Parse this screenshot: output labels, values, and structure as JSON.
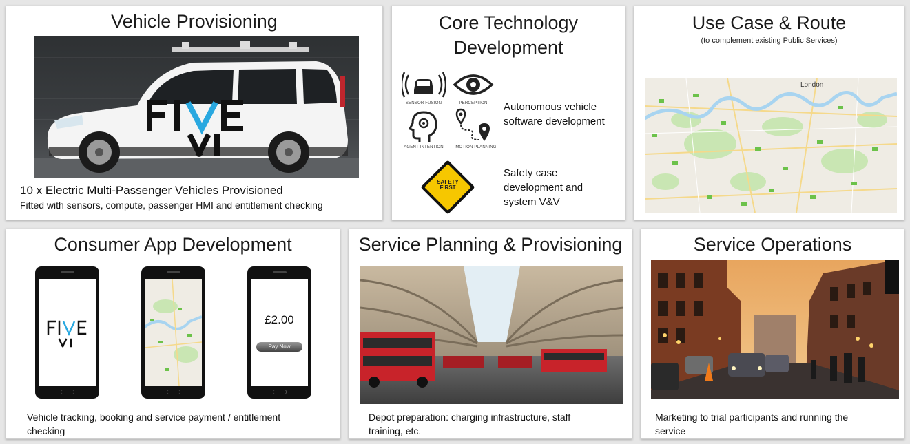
{
  "panels": {
    "vehicle": {
      "title": "Vehicle Provisioning",
      "brand": "FIVE AI",
      "caption_main": "10 x Electric Multi-Passenger Vehicles Provisioned",
      "caption_sub": "Fitted with sensors, compute, passenger HMI and entitlement checking"
    },
    "core_tech": {
      "title_line1": "Core Technology",
      "title_line2": "Development",
      "icon_labels": {
        "sensor_fusion": "Sensor Fusion",
        "perception": "Perception",
        "agent_intention": "Agent Intention",
        "motion_planning": "Motion Planning"
      },
      "safety_sign_line1": "SAFETY",
      "safety_sign_line2": "FIRST",
      "text1_line1": "Autonomous vehicle",
      "text1_line2": "software development",
      "text2_line1": "Safety case",
      "text2_line2": "development and",
      "text2_line3": "system V&V"
    },
    "use_case": {
      "title": "Use Case & Route",
      "subtitle": "(to complement existing Public Services)",
      "map_label": "London"
    },
    "consumer_app": {
      "title": "Consumer App Development",
      "phone1_brand": "FIVE AI",
      "phone3_price": "£2.00",
      "phone3_button": "Pay Now",
      "caption_line1": "Vehicle tracking, booking and service payment / entitlement",
      "caption_line2": "checking"
    },
    "service_planning": {
      "title": "Service Planning & Provisioning",
      "caption_line1": "Depot preparation: charging infrastructure, staff",
      "caption_line2": "training, etc."
    },
    "service_ops": {
      "title": "Service Operations",
      "caption_line1": "Marketing to trial participants and running the",
      "caption_line2": "service"
    }
  },
  "colors": {
    "accent_blue": "#29a8e0",
    "bus_red": "#c8232a",
    "sign_yellow": "#f6c700",
    "map_green": "#bfe3a6",
    "river_blue": "#a8d4f0"
  }
}
